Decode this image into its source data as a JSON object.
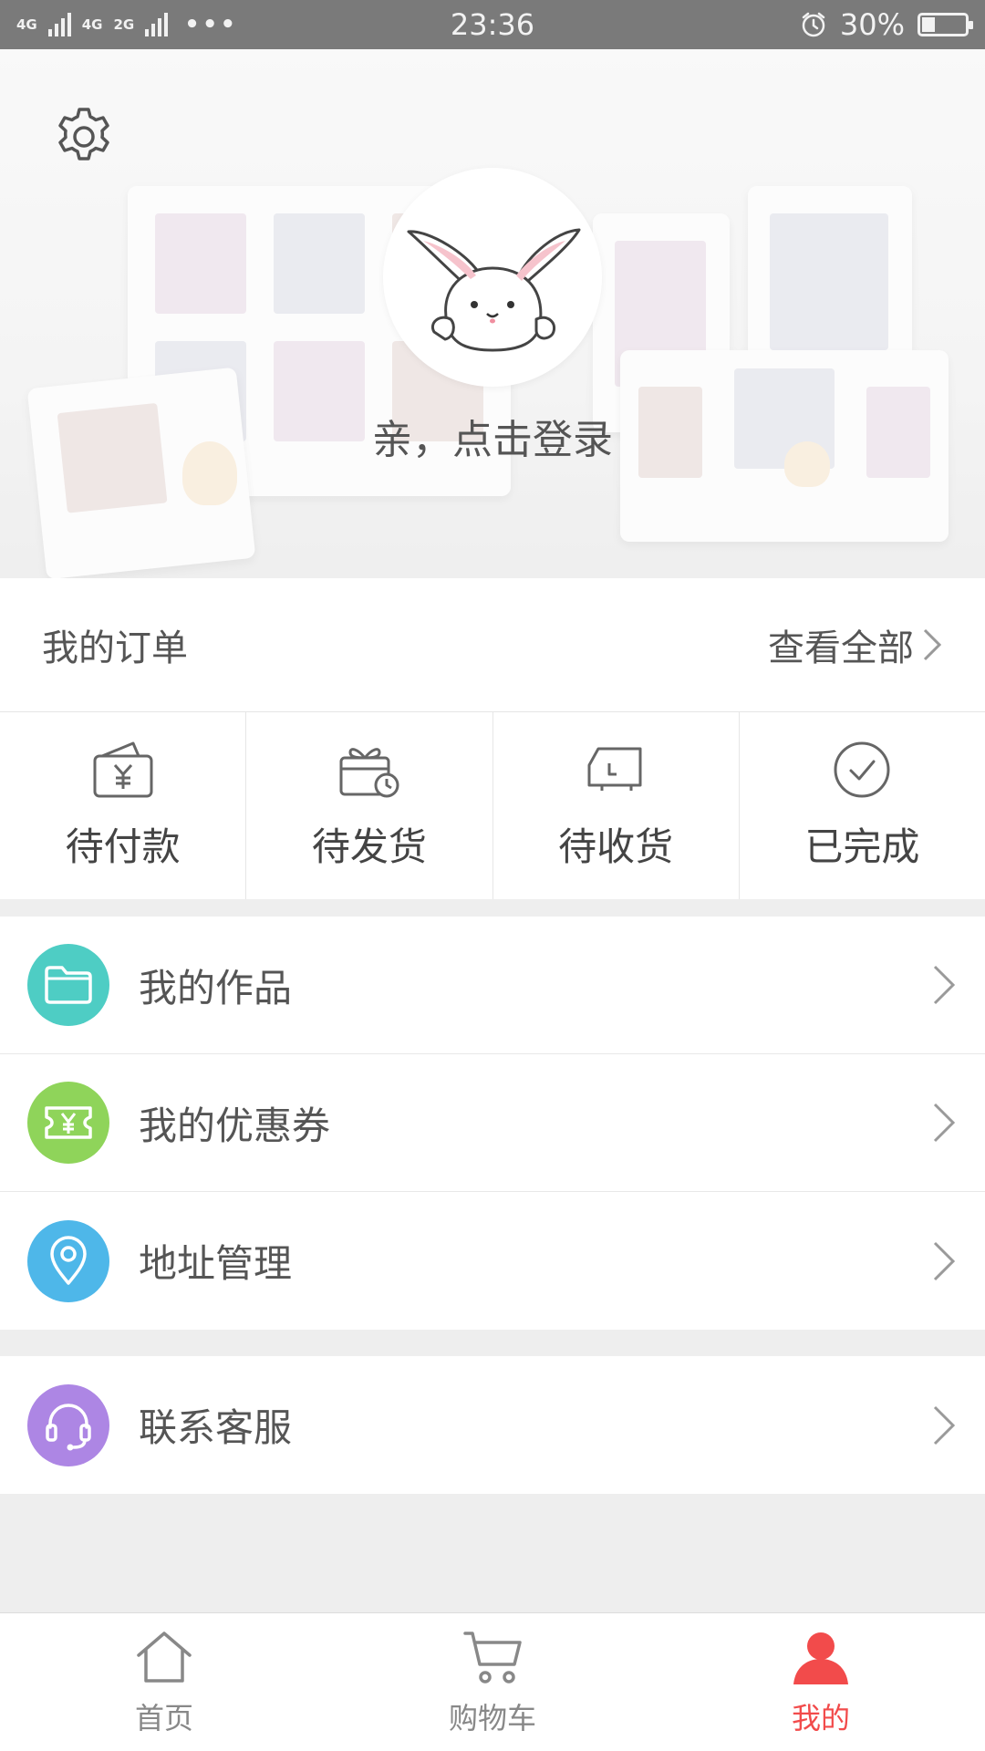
{
  "status_bar": {
    "network_1": "4G",
    "network_2": "4G",
    "network_3": "2G",
    "time": "23:36",
    "battery_percent_label": "30%",
    "battery_level": 0.3
  },
  "profile": {
    "login_prompt": "亲，点击登录"
  },
  "orders": {
    "title": "我的订单",
    "view_all": "查看全部",
    "items": [
      {
        "label": "待付款",
        "icon": "wallet-yen-icon"
      },
      {
        "label": "待发货",
        "icon": "gift-clock-icon"
      },
      {
        "label": "待收货",
        "icon": "truck-icon"
      },
      {
        "label": "已完成",
        "icon": "check-circle-icon"
      }
    ]
  },
  "menu": {
    "items": [
      {
        "label": "我的作品",
        "icon": "folder-icon",
        "color": "#4ecdc4"
      },
      {
        "label": "我的优惠券",
        "icon": "coupon-icon",
        "color": "#8fd45a"
      },
      {
        "label": "地址管理",
        "icon": "location-icon",
        "color": "#4eb7e9"
      }
    ],
    "service": {
      "label": "联系客服",
      "icon": "headset-icon",
      "color": "#ad86e4"
    }
  },
  "tabbar": {
    "tabs": [
      {
        "label": "首页",
        "icon": "home-icon"
      },
      {
        "label": "购物车",
        "icon": "cart-icon"
      },
      {
        "label": "我的",
        "icon": "user-icon"
      }
    ],
    "active_color": "#f24b4b"
  }
}
